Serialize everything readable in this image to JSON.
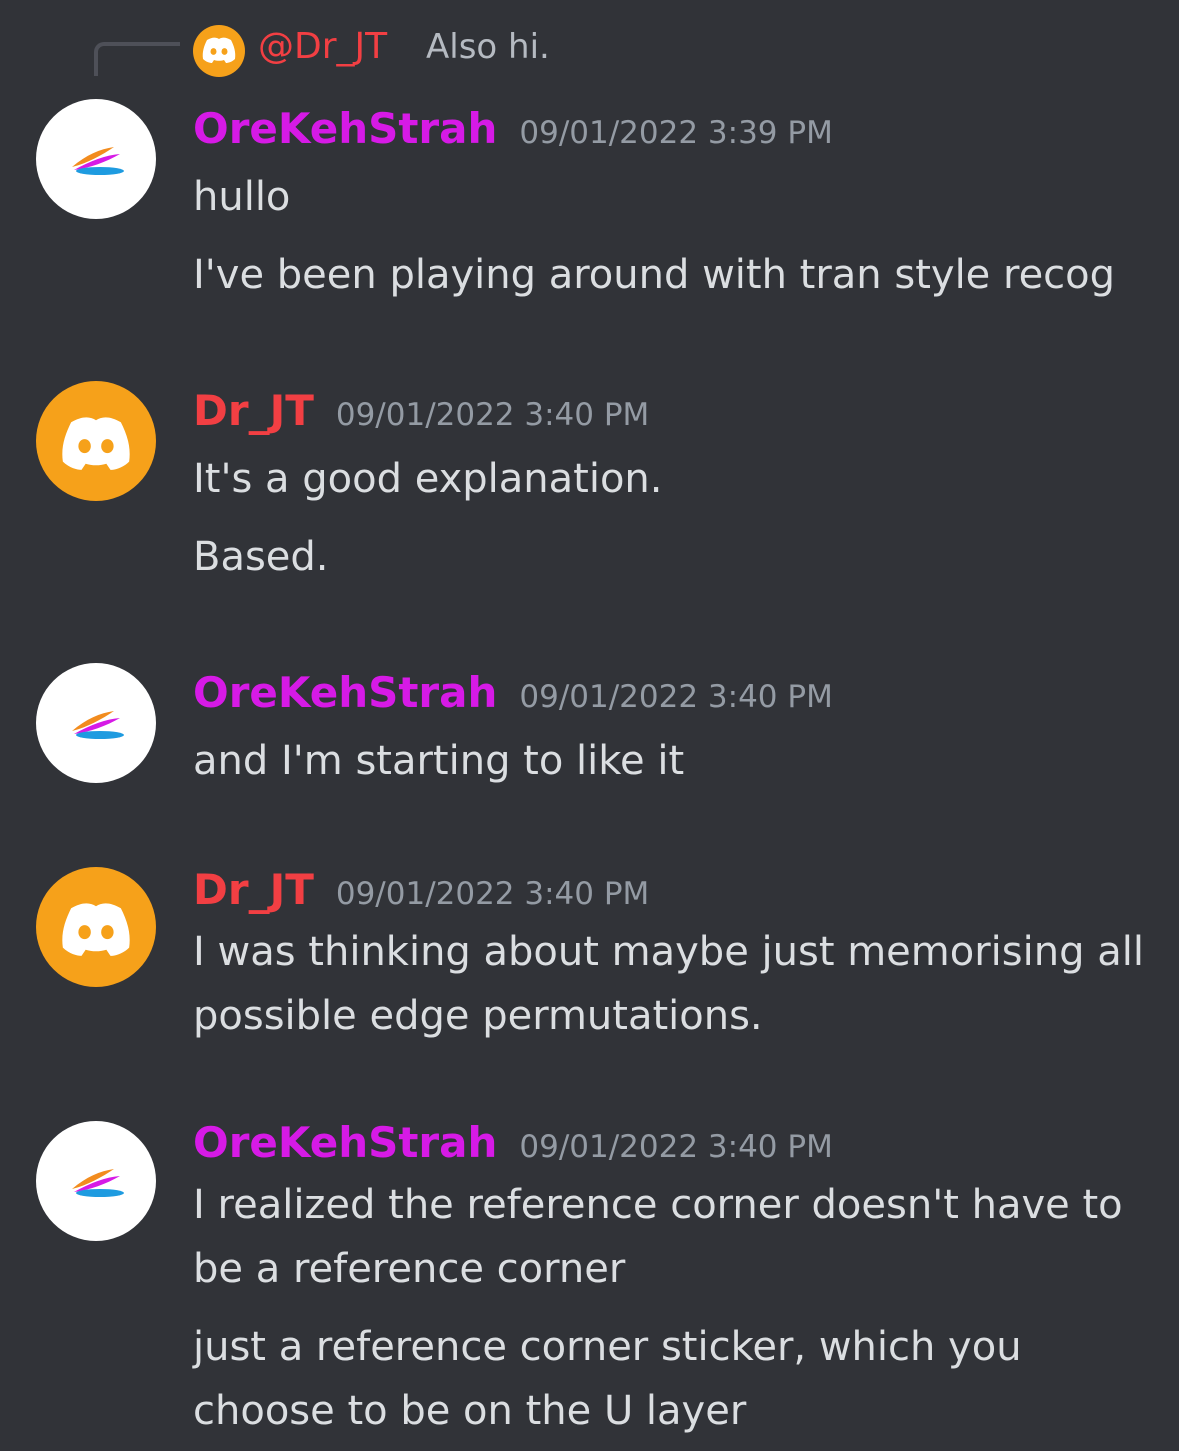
{
  "colors": {
    "background": "#313338",
    "orekehstrah_name": "#d61ae6",
    "drjt_name": "#f23f43",
    "timestamp": "#949ba4",
    "message_text": "#dbdee1",
    "discord_avatar": "#f6a11a"
  },
  "reply": {
    "author": "@Dr_JT",
    "text": "Also hi."
  },
  "messages": [
    {
      "author": "OreKehStrah",
      "timestamp": "09/01/2022 3:39 PM",
      "avatar": "feather-icon",
      "lines": [
        "hullo",
        "I've been playing around with tran style recog"
      ]
    },
    {
      "author": "Dr_JT",
      "timestamp": "09/01/2022 3:40 PM",
      "avatar": "discord-logo-icon",
      "lines": [
        "It's a good explanation.",
        "Based."
      ]
    },
    {
      "author": "OreKehStrah",
      "timestamp": "09/01/2022 3:40 PM",
      "avatar": "feather-icon",
      "lines": [
        "and I'm starting to like it"
      ]
    },
    {
      "author": "Dr_JT",
      "timestamp": "09/01/2022 3:40 PM",
      "avatar": "discord-logo-icon",
      "lines": [
        "I was thinking about maybe just memorising all",
        "possible edge permutations."
      ]
    },
    {
      "author": "OreKehStrah",
      "timestamp": "09/01/2022 3:40 PM",
      "avatar": "feather-icon",
      "lines": [
        "I realized the reference corner doesn't have to",
        "be a reference corner",
        "just a reference corner sticker, which you",
        "choose to be on the U layer"
      ]
    }
  ]
}
